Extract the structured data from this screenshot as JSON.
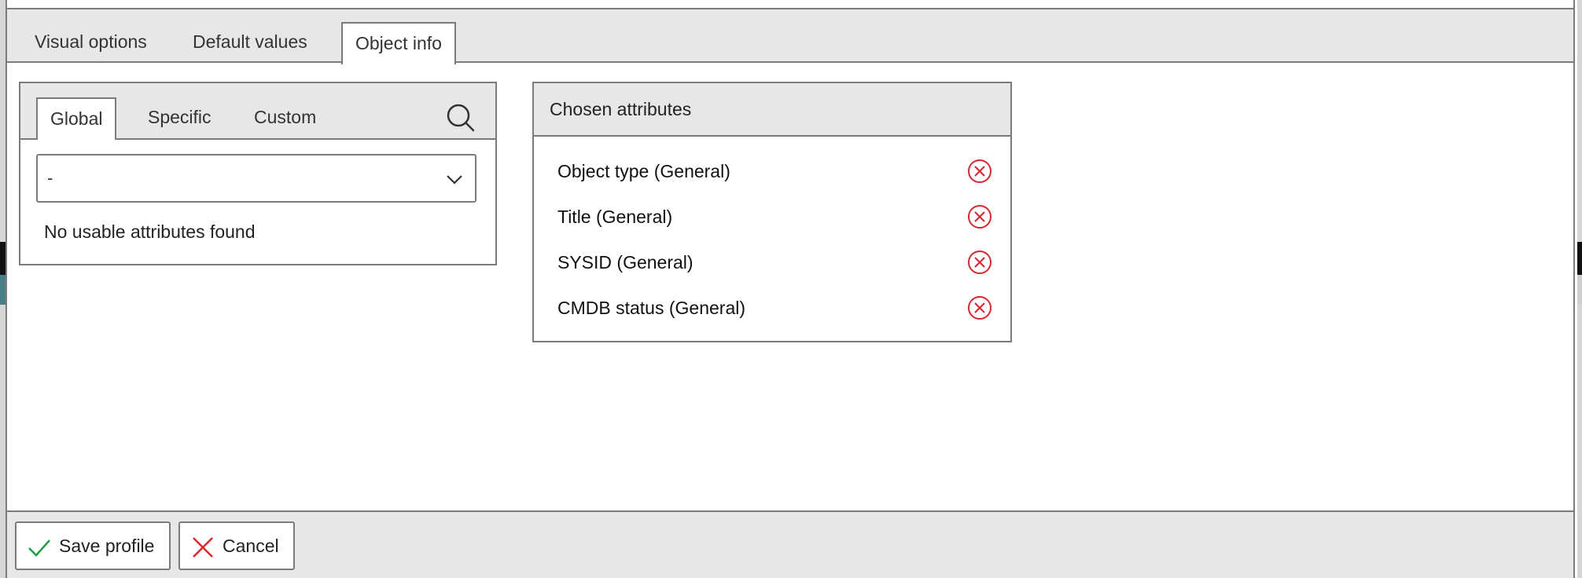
{
  "tabs": {
    "visual_options": "Visual options",
    "default_values": "Default values",
    "object_info": "Object info"
  },
  "attribute_panel": {
    "tabs": {
      "global": "Global",
      "specific": "Specific",
      "custom": "Custom"
    },
    "select_value": "-",
    "empty_message": "No usable attributes found"
  },
  "chosen": {
    "title": "Chosen attributes",
    "items": [
      {
        "label": "Object type (General)"
      },
      {
        "label": "Title (General)"
      },
      {
        "label": "SYSID (General)"
      },
      {
        "label": "CMDB status (General)"
      }
    ]
  },
  "footer": {
    "save_label": "Save profile",
    "cancel_label": "Cancel"
  },
  "colors": {
    "remove_icon": "#d9262e",
    "save_icon": "#1e9e4a",
    "cancel_icon": "#d9262e",
    "panel_bg": "#e6e7e6",
    "border": "#7b7b7b"
  },
  "icons": {
    "search": "search-icon",
    "dropdown": "chevron-down-icon",
    "remove": "remove-circle-icon",
    "save": "checkmark-icon",
    "cancel": "close-icon"
  }
}
